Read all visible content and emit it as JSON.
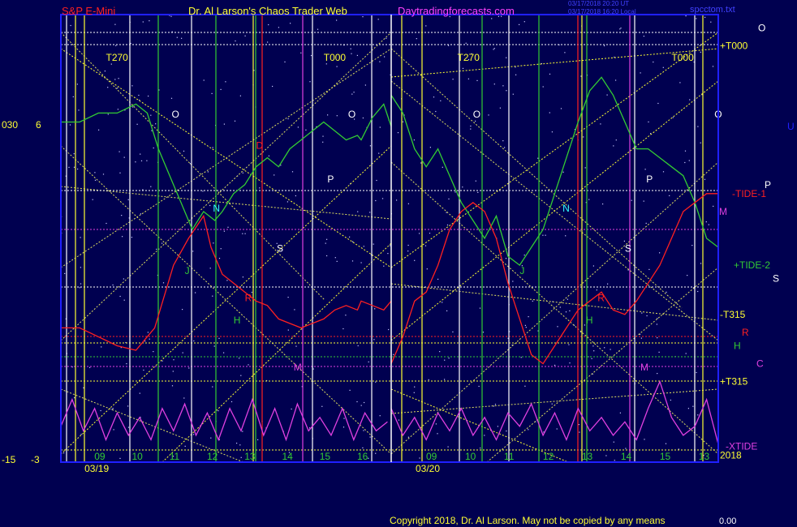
{
  "header": {
    "symbol": "S&P E-Mini",
    "title": "Dr. Al Larson's Chaos Trader Web",
    "site": "Daytradingforecasts.com",
    "stamp1": "03/17/2018 20:20 UT",
    "stamp2": "03/17/2018 16:20 Local",
    "file": "spcctom.txt"
  },
  "left_axis": {
    "upper": [
      "030",
      "6"
    ],
    "lower": [
      "-15",
      "-3"
    ]
  },
  "footer": {
    "copyright": "Copyright 2018, Dr. Al Larson. May not be copied by any means",
    "readout": "0.00"
  },
  "colors": {
    "background": "#000050",
    "frame": "#2020ff",
    "green": "#33cc33",
    "red": "#ff2020",
    "magenta": "#e040e0",
    "yellow": "#ffff33",
    "cyan": "#33ffff",
    "white": "#ffffff"
  },
  "chart_data": {
    "type": "line",
    "title": "S&P E-Mini",
    "x_range": [
      "03/19 08:00",
      "03/20 13:00"
    ],
    "dates": [
      {
        "label": "03/19",
        "hour": 8.5
      },
      {
        "label": "03/20",
        "hour": 32.5
      }
    ],
    "hour_ticks": [
      {
        "label": "09",
        "hour": 9
      },
      {
        "label": "10",
        "hour": 10
      },
      {
        "label": "11",
        "hour": 11
      },
      {
        "label": "12",
        "hour": 12
      },
      {
        "label": "13",
        "hour": 13
      },
      {
        "label": "14",
        "hour": 14
      },
      {
        "label": "15",
        "hour": 15
      },
      {
        "label": "16",
        "hour": 16
      },
      {
        "label": "09",
        "hour": 33
      },
      {
        "label": "10",
        "hour": 34
      },
      {
        "label": "11",
        "hour": 35
      },
      {
        "label": "12",
        "hour": 36
      },
      {
        "label": "13",
        "hour": 37
      },
      {
        "label": "14",
        "hour": 38
      },
      {
        "label": "15",
        "hour": 39
      },
      {
        "label": "13",
        "hour": 40
      }
    ],
    "time_markers": [
      {
        "label": "T270",
        "hour": 9.2
      },
      {
        "label": "T000",
        "hour": 15.0
      },
      {
        "label": "T270",
        "hour": 33.7
      },
      {
        "label": "T000",
        "hour": 39.2
      }
    ],
    "right_labels": [
      {
        "label": "O",
        "value": 0.97
      },
      {
        "label": "+T000",
        "value": 0.93
      },
      {
        "label": "U",
        "value": 0.75
      },
      {
        "label": "P",
        "value": 0.62
      },
      {
        "label": "-TIDE-1",
        "value": 0.6
      },
      {
        "label": "M",
        "value": 0.56
      },
      {
        "label": "+TIDE-2",
        "value": 0.44
      },
      {
        "label": "S",
        "value": 0.41
      },
      {
        "label": "-T315",
        "value": 0.33
      },
      {
        "label": "R",
        "value": 0.29
      },
      {
        "label": "H",
        "value": 0.26
      },
      {
        "label": "C",
        "value": 0.22
      },
      {
        "label": "+T315",
        "value": 0.18
      },
      {
        "label": "-XTIDE",
        "value": 0.035
      },
      {
        "label": "2018",
        "value": 0.015
      }
    ],
    "point_labels": [
      {
        "label": "O",
        "hour": 10.95,
        "value": 0.77,
        "color": "white"
      },
      {
        "label": "O",
        "hour": 15.65,
        "value": 0.77,
        "color": "white"
      },
      {
        "label": "O",
        "hour": 34.1,
        "value": 0.77,
        "color": "white"
      },
      {
        "label": "O",
        "hour": 40.3,
        "value": 0.77,
        "color": "white"
      },
      {
        "label": "P",
        "hour": 15.1,
        "value": 0.625,
        "color": "white"
      },
      {
        "label": "P",
        "hour": 38.55,
        "value": 0.625,
        "color": "white"
      },
      {
        "label": "N",
        "hour": 12.05,
        "value": 0.56,
        "color": "cyan"
      },
      {
        "label": "N",
        "hour": 36.4,
        "value": 0.56,
        "color": "cyan"
      },
      {
        "label": "S",
        "hour": 13.75,
        "value": 0.47,
        "color": "white"
      },
      {
        "label": "S",
        "hour": 38.0,
        "value": 0.47,
        "color": "white"
      },
      {
        "label": "J",
        "hour": 11.3,
        "value": 0.42,
        "color": "green"
      },
      {
        "label": "J",
        "hour": 35.3,
        "value": 0.42,
        "color": "green"
      },
      {
        "label": "R",
        "hour": 12.9,
        "value": 0.36,
        "color": "red"
      },
      {
        "label": "R",
        "hour": 37.3,
        "value": 0.36,
        "color": "red"
      },
      {
        "label": "H",
        "hour": 12.6,
        "value": 0.31,
        "color": "green"
      },
      {
        "label": "H",
        "hour": 37.0,
        "value": 0.31,
        "color": "green"
      },
      {
        "label": "M",
        "hour": 14.2,
        "value": 0.205,
        "color": "magenta"
      },
      {
        "label": "M",
        "hour": 38.4,
        "value": 0.205,
        "color": "magenta"
      },
      {
        "label": "D",
        "hour": 13.2,
        "value": 0.7,
        "color": "red"
      }
    ],
    "series": [
      {
        "name": "price",
        "color": "green",
        "x": [
          8.0,
          8.5,
          9.0,
          9.5,
          10.0,
          10.3,
          10.6,
          10.9,
          11.2,
          11.5,
          11.8,
          12.1,
          12.3,
          12.6,
          12.9,
          13.2,
          13.5,
          13.8,
          14.1,
          14.4,
          14.7,
          15.0,
          15.3,
          15.6,
          15.9,
          16.0,
          16.3,
          16.6,
          16.8,
          32.0,
          32.3,
          32.6,
          32.9,
          33.2,
          33.5,
          33.8,
          34.1,
          34.4,
          34.7,
          35.0,
          35.3,
          35.6,
          35.9,
          36.2,
          36.5,
          36.8,
          37.1,
          37.4,
          37.7,
          38.0,
          38.3,
          38.6,
          38.9,
          39.2,
          39.5,
          39.8,
          40.1,
          40.4
        ],
        "values": [
          0.76,
          0.76,
          0.78,
          0.78,
          0.8,
          0.78,
          0.7,
          0.64,
          0.58,
          0.52,
          0.56,
          0.54,
          0.56,
          0.6,
          0.62,
          0.66,
          0.68,
          0.66,
          0.7,
          0.72,
          0.74,
          0.76,
          0.74,
          0.72,
          0.73,
          0.72,
          0.77,
          0.8,
          0.75,
          0.82,
          0.78,
          0.7,
          0.66,
          0.7,
          0.64,
          0.58,
          0.54,
          0.5,
          0.55,
          0.46,
          0.44,
          0.48,
          0.52,
          0.6,
          0.68,
          0.76,
          0.83,
          0.86,
          0.82,
          0.76,
          0.7,
          0.7,
          0.68,
          0.66,
          0.64,
          0.58,
          0.5,
          0.48
        ]
      },
      {
        "name": "TIDE-1",
        "color": "red",
        "x": [
          8.0,
          8.5,
          9.0,
          9.5,
          10.0,
          10.5,
          11.0,
          11.4,
          11.8,
          12.0,
          12.3,
          12.6,
          12.9,
          13.2,
          13.5,
          13.8,
          14.1,
          14.4,
          14.7,
          15.0,
          15.3,
          15.6,
          15.9,
          16.0,
          16.3,
          16.6,
          16.8,
          32.0,
          32.3,
          32.6,
          32.9,
          33.2,
          33.5,
          33.8,
          34.1,
          34.4,
          34.7,
          35.0,
          35.3,
          35.6,
          35.9,
          36.2,
          36.5,
          36.8,
          37.1,
          37.4,
          37.7,
          38.0,
          38.3,
          38.6,
          38.9,
          39.2,
          39.5,
          39.8,
          40.1,
          40.4
        ],
        "values": [
          0.3,
          0.3,
          0.28,
          0.26,
          0.25,
          0.3,
          0.44,
          0.5,
          0.55,
          0.48,
          0.42,
          0.4,
          0.38,
          0.36,
          0.35,
          0.32,
          0.31,
          0.3,
          0.31,
          0.32,
          0.34,
          0.35,
          0.34,
          0.36,
          0.35,
          0.34,
          0.36,
          0.22,
          0.28,
          0.36,
          0.38,
          0.44,
          0.52,
          0.56,
          0.58,
          0.56,
          0.5,
          0.4,
          0.32,
          0.24,
          0.22,
          0.26,
          0.3,
          0.34,
          0.36,
          0.38,
          0.34,
          0.33,
          0.36,
          0.4,
          0.44,
          0.5,
          0.56,
          0.58,
          0.6,
          0.6
        ]
      },
      {
        "name": "XTIDE",
        "color": "magenta",
        "x": [
          8.0,
          8.3,
          8.6,
          8.9,
          9.2,
          9.5,
          9.8,
          10.1,
          10.4,
          10.7,
          11.0,
          11.3,
          11.6,
          11.9,
          12.2,
          12.5,
          12.8,
          13.1,
          13.4,
          13.7,
          14.0,
          14.3,
          14.6,
          14.9,
          15.2,
          15.5,
          15.8,
          16.1,
          16.4,
          16.7,
          32.0,
          32.3,
          32.6,
          32.9,
          33.2,
          33.5,
          33.8,
          34.1,
          34.4,
          34.7,
          35.0,
          35.3,
          35.6,
          35.9,
          36.2,
          36.5,
          36.8,
          37.1,
          37.4,
          37.7,
          38.0,
          38.3,
          38.6,
          38.9,
          39.2,
          39.5,
          39.8,
          40.1,
          40.4
        ],
        "values": [
          0.08,
          0.14,
          0.07,
          0.12,
          0.05,
          0.11,
          0.06,
          0.1,
          0.05,
          0.12,
          0.07,
          0.13,
          0.06,
          0.11,
          0.05,
          0.12,
          0.07,
          0.14,
          0.06,
          0.12,
          0.05,
          0.13,
          0.07,
          0.1,
          0.06,
          0.12,
          0.05,
          0.11,
          0.07,
          0.09,
          0.12,
          0.06,
          0.1,
          0.05,
          0.11,
          0.07,
          0.12,
          0.06,
          0.1,
          0.05,
          0.11,
          0.08,
          0.13,
          0.06,
          0.11,
          0.05,
          0.12,
          0.07,
          0.1,
          0.06,
          0.09,
          0.05,
          0.12,
          0.18,
          0.1,
          0.06,
          0.08,
          0.14,
          0.04
        ]
      }
    ]
  }
}
